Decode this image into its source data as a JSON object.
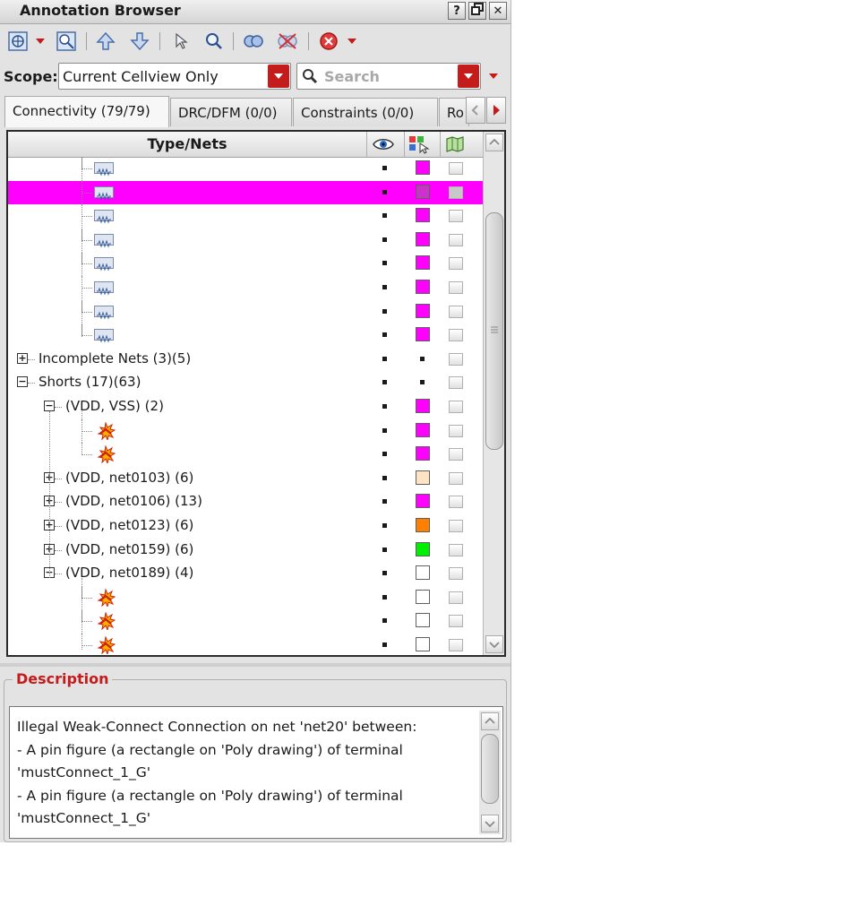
{
  "window": {
    "title": "Annotation Browser",
    "help_label": "?",
    "close_label": "✕"
  },
  "toolbar": {
    "icons": [
      "zoom-fit-icon",
      "zoom-select-icon",
      "arrow-up-icon",
      "arrow-down-icon",
      "pointer-icon",
      "magnifier-icon",
      "link-icon",
      "unlink-icon",
      "error-icon"
    ]
  },
  "scope": {
    "label": "Scope:",
    "value": "Current Cellview Only",
    "search_placeholder": "Search"
  },
  "tabs": [
    {
      "label": "Connectivity (79/79)",
      "active": true
    },
    {
      "label": "DRC/DFM (0/0)",
      "active": false
    },
    {
      "label": "Constraints (0/0)",
      "active": false
    },
    {
      "label": "Ro",
      "active": false
    }
  ],
  "tree": {
    "header": "Type/Nets",
    "rows": [
      {
        "kind": "res",
        "label": "",
        "color": "#ff00ff",
        "selected": false
      },
      {
        "kind": "res",
        "label": "",
        "color": "#cc33cc",
        "selected": true
      },
      {
        "kind": "res",
        "label": "",
        "color": "#ff00ff",
        "selected": false
      },
      {
        "kind": "res",
        "label": "",
        "color": "#ff00ff",
        "selected": false
      },
      {
        "kind": "res",
        "label": "",
        "color": "#ff00ff",
        "selected": false
      },
      {
        "kind": "res",
        "label": "",
        "color": "#ff00ff",
        "selected": false
      },
      {
        "kind": "res",
        "label": "",
        "color": "#ff00ff",
        "selected": false
      },
      {
        "kind": "res",
        "label": "",
        "color": "#ff00ff",
        "selected": false
      },
      {
        "kind": "group",
        "label": "Incomplete Nets (3)(5)",
        "expanded": false,
        "color": null
      },
      {
        "kind": "group",
        "label": "Shorts (17)(63)",
        "expanded": true,
        "color": null
      },
      {
        "kind": "sub",
        "label": "(VDD, VSS) (2)",
        "expanded": true,
        "color": "#ff00ff"
      },
      {
        "kind": "short",
        "label": "",
        "color": "#ff00ff"
      },
      {
        "kind": "short",
        "label": "",
        "color": "#ff00ff"
      },
      {
        "kind": "sub",
        "label": "(VDD, net0103) (6)",
        "expanded": false,
        "color": "#ffe4c4"
      },
      {
        "kind": "sub",
        "label": "(VDD, net0106) (13)",
        "expanded": false,
        "color": "#ff00ff"
      },
      {
        "kind": "sub",
        "label": "(VDD, net0123) (6)",
        "expanded": false,
        "color": "#ff8000"
      },
      {
        "kind": "sub",
        "label": "(VDD, net0159) (6)",
        "expanded": false,
        "color": "#00ee00"
      },
      {
        "kind": "sub",
        "label": "(VDD, net0189) (4)",
        "expanded": true,
        "color": "#ffffff"
      },
      {
        "kind": "short",
        "label": "",
        "color": "#ffffff"
      },
      {
        "kind": "short",
        "label": "",
        "color": "#ffffff"
      },
      {
        "kind": "short",
        "label": "",
        "color": "#ffffff"
      }
    ]
  },
  "description": {
    "title": "Description",
    "lines": [
      "Illegal Weak-Connect Connection on net 'net20' between:",
      "- A pin figure (a rectangle on 'Poly drawing') of terminal",
      "'mustConnect_1_G'",
      "- A pin figure (a rectangle on 'Poly drawing') of terminal",
      "'mustConnect_1_G'"
    ]
  }
}
